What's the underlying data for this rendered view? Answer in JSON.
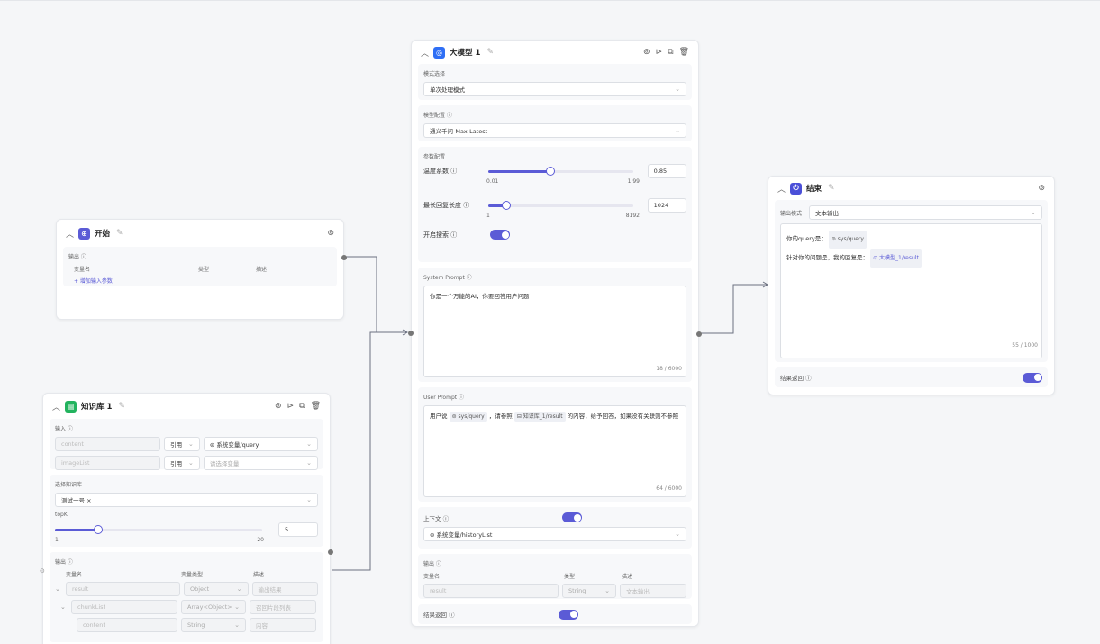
{
  "llm": {
    "title": "大模型 1",
    "mode_label": "模式选择",
    "mode_value": "单次处理模式",
    "model_label": "模型配置 ⓘ",
    "model_value": "通义千问-Max-Latest",
    "param_label": "参数配置",
    "temp_label": "温度系数 ⓘ",
    "temp_min": "0.01",
    "temp_max": "1.99",
    "temp_value": "0.85",
    "temp_fraction": 0.43,
    "maxlen_label": "最长回复长度 ⓘ",
    "maxlen_min": "1",
    "maxlen_max": "8192",
    "maxlen_value": "1024",
    "maxlen_fraction": 0.125,
    "search_label": "开启搜索 ⓘ",
    "system_prompt_label": "System Prompt ⓘ",
    "system_prompt_text": "你是一个万能的AI，你要回答用户问题",
    "system_prompt_count": "18 / 6000",
    "user_prompt_label": "User Prompt ⓘ",
    "user_prompt_pre": "用户说",
    "user_prompt_var1": "⊜ sys/query",
    "user_prompt_mid": "，请参照",
    "user_prompt_var2": "⊟ 知识库_1/result",
    "user_prompt_post": "的内容，给予回答，如果没有关联则不参照",
    "user_prompt_count": "64 / 6000",
    "context_label": "上下文 ⓘ",
    "context_value": "⊜ 系统变量/historyList",
    "output_label": "输出 ⓘ",
    "col_name": "变量名",
    "col_type": "类型",
    "col_desc": "描述",
    "out_name": "result",
    "out_type": "String",
    "out_desc": "文本输出",
    "return_label": "结果返回 ⓘ"
  },
  "start": {
    "title": "开始",
    "output_label": "输出 ⓘ",
    "col_name": "变量名",
    "col_type": "类型",
    "col_desc": "描述",
    "add_label": "+ 增加输入参数"
  },
  "kb": {
    "title": "知识库 1",
    "input_label": "输入 ⓘ",
    "row1_name": "content",
    "row1_mode": "引用",
    "row1_value": "⊜ 系统变量/query",
    "row2_name": "imageList",
    "row2_mode": "引用",
    "row2_value": "请选择变量",
    "kb_label": "选择知识库",
    "kb_value": "测试一号 ×",
    "topk_label": "topK",
    "topk_min": "1",
    "topk_max": "20",
    "topk_value": "5",
    "topk_fraction": 0.21,
    "output_label": "输出 ⓘ",
    "col_name": "变量名",
    "col_type": "变量类型",
    "col_desc": "描述",
    "out1_name": "result",
    "out1_type": "Object",
    "out1_desc": "输出结果",
    "out2_name": "chunkList",
    "out2_type": "Array<Object>",
    "out2_desc": "召回片段列表",
    "out3_name": "content",
    "out3_type": "String",
    "out3_desc": "内容"
  },
  "end": {
    "title": "结束",
    "mode_label": "输出模式",
    "mode_value": "文本输出",
    "line1_text": "你的query是：",
    "line1_var": "⊜ sys/query",
    "line2_text": "针对你的问题是，我的回复是：",
    "line2_var": "⊙ 大模型_1/result",
    "count": "55 / 1000",
    "return_label": "结果返回 ⓘ"
  },
  "colors": {
    "accent": "#5b5bd6",
    "llm_icon": "#2f6ff5",
    "start_icon": "#5b5bd6",
    "kb_icon": "#22b35e",
    "end_icon": "#4a4fd8"
  }
}
